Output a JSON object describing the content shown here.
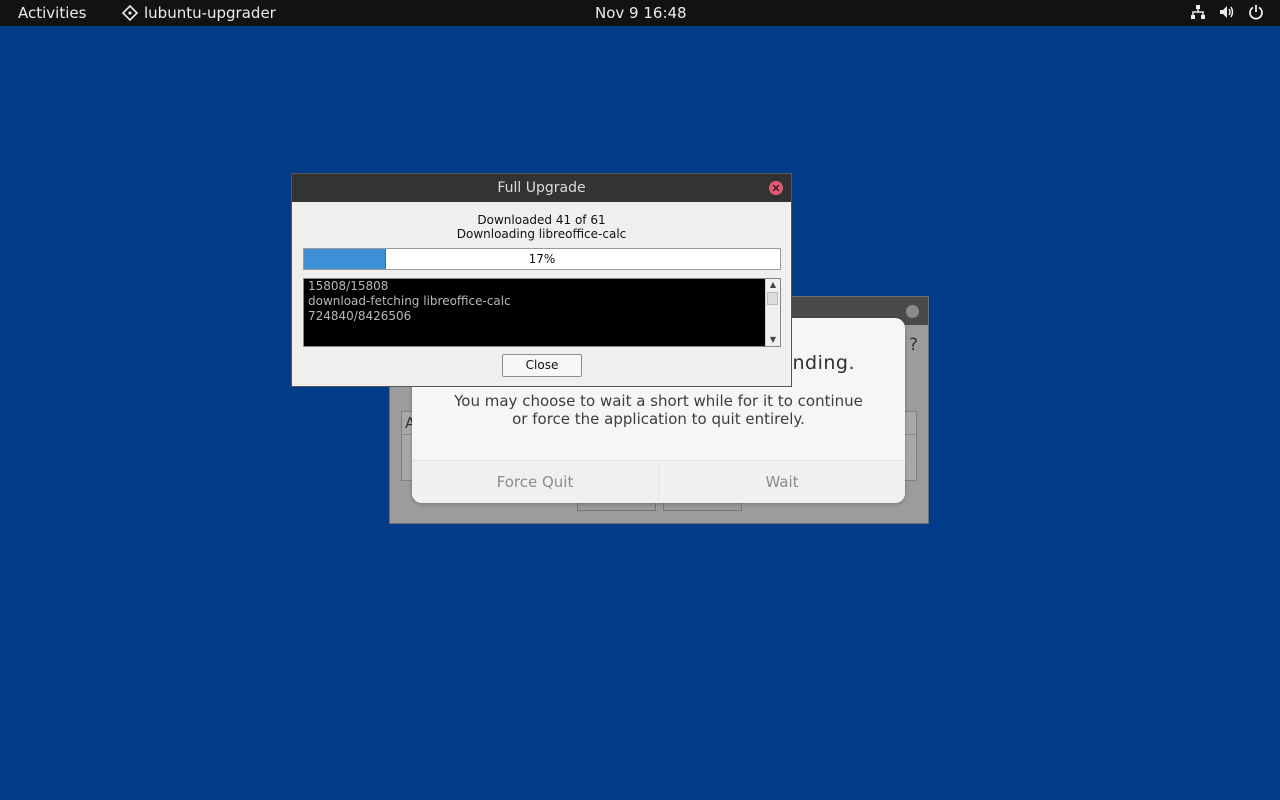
{
  "topbar": {
    "activities": "Activities",
    "app_name": "lubuntu-upgrader",
    "clock": "Nov 9  16:48",
    "icons": [
      "network-icon",
      "volume-icon",
      "power-icon"
    ]
  },
  "background_window": {
    "partial_question_mark": "?",
    "partial_dot": ".",
    "partial_column_header": "A"
  },
  "not_responding_dialog": {
    "heading_partial": "nding.",
    "body_line1": "You may choose to wait a short while for it to continue",
    "body_line2": "or force the application to quit entirely.",
    "force_quit_label": "Force Quit",
    "wait_label": "Wait"
  },
  "full_upgrade_dialog": {
    "title": "Full Upgrade",
    "status_line1": "Downloaded 41 of 61",
    "status_line2": "Downloading libreoffice-calc",
    "progress_percent": 17,
    "progress_label": "17%",
    "log_lines": [
      "15808/15808",
      "download-fetching libreoffice-calc",
      "724840/8426506"
    ],
    "close_label": "Close"
  },
  "colors": {
    "desktop": "#023c88",
    "progress_fill": "#3d8fd6",
    "window_close": "#e05a73"
  }
}
